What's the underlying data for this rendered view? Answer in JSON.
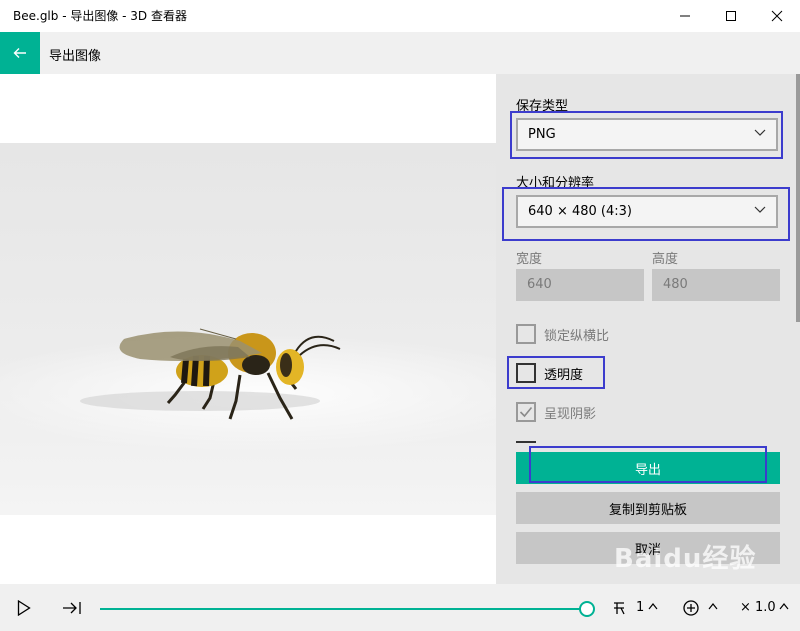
{
  "window": {
    "title": "Bee.glb - 导出图像 - 3D 查看器"
  },
  "appbar": {
    "title": "导出图像"
  },
  "panel": {
    "save_type_label": "保存类型",
    "save_type_value": "PNG",
    "size_label": "大小和分辨率",
    "size_value": "640 × 480 (4:3)",
    "width_label": "宽度",
    "width_value": "640",
    "height_label": "高度",
    "height_value": "480",
    "lock_ratio_label": "锁定纵横比",
    "lock_ratio_checked": false,
    "transparency_label": "透明度",
    "transparency_checked": false,
    "shadow_label": "呈现阴影",
    "shadow_checked": true,
    "export_button": "导出",
    "copy_button": "复制到剪贴板",
    "cancel_button": "取消"
  },
  "bottombar": {
    "playback_speed": "1",
    "zoom": "× 1.0"
  },
  "watermark": "Baidu经验",
  "colors": {
    "accent": "#00b294",
    "highlight": "#3c3ccd"
  }
}
